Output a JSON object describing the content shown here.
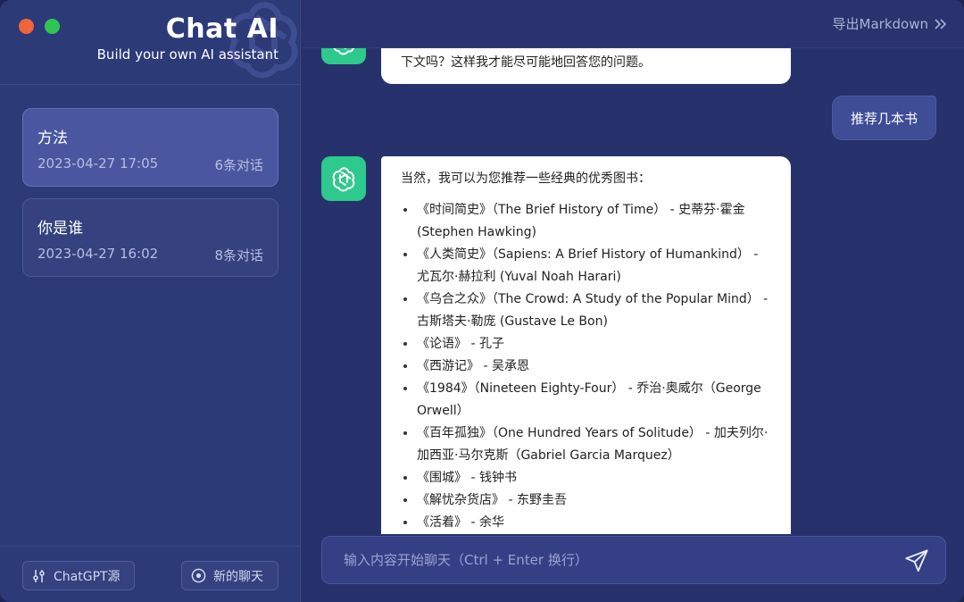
{
  "brand": {
    "title": "Chat AI",
    "subtitle": "Build your own AI assistant"
  },
  "sessions": [
    {
      "title": "方法",
      "time": "2023-04-27 17:05",
      "count": "6条对话",
      "active": true
    },
    {
      "title": "你是谁",
      "time": "2023-04-27 16:02",
      "count": "8条对话",
      "active": false
    }
  ],
  "footer": {
    "source_label": "ChatGPT源",
    "new_chat_label": "新的聊天"
  },
  "topbar": {
    "export_label": "导出Markdown"
  },
  "messages": {
    "m1_text": "下文吗？这样我才能尽可能地回答您的问题。",
    "m2_text": "推荐几本书",
    "m3_intro": "当然，我可以为您推荐一些经典的优秀图书：",
    "m3_items": [
      "《时间简史》（The Brief History of Time） - 史蒂芬·霍金 (Stephen Hawking)",
      "《人类简史》（Sapiens: A Brief History of Humankind） - 尤瓦尔·赫拉利 (Yuval Noah Harari)",
      "《乌合之众》（The Crowd: A Study of the Popular Mind） - 古斯塔夫·勒庞 (Gustave Le Bon)",
      "《论语》 - 孔子",
      "《西游记》 - 吴承恩",
      "《1984》（Nineteen Eighty-Four） - 乔治·奥威尔（George Orwell）",
      "《百年孤独》（One Hundred Years of Solitude） - 加夫列尔·加西亚·马尔克斯（Gabriel Garcia Marquez）",
      "《围城》 - 钱钟书",
      "《解忧杂货店》 - 东野圭吾",
      "《活着》 - 余华"
    ]
  },
  "input": {
    "placeholder": "输入内容开始聊天（Ctrl + Enter 换行）"
  },
  "icons": {
    "send": "send-icon",
    "settings": "sliders-icon",
    "new": "plus-circle-icon",
    "export": "double-chevron-right-icon",
    "avatar": "openai-logo-icon"
  },
  "colors": {
    "accent_green": "#2ec98c",
    "sidebar": "#2d3a78",
    "main": "#27316b"
  }
}
